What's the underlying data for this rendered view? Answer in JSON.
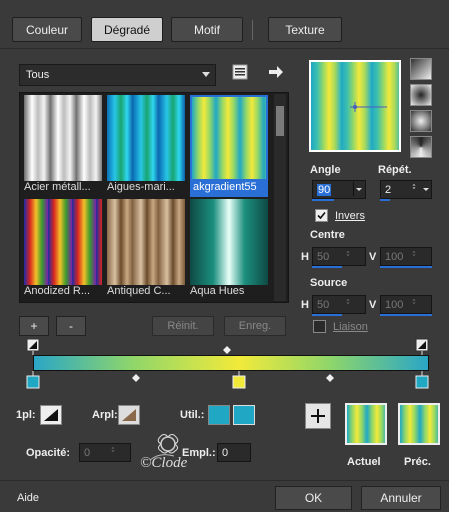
{
  "tabs": [
    {
      "label": "Couleur",
      "active": false
    },
    {
      "label": "Dégradé",
      "active": true
    },
    {
      "label": "Motif",
      "active": false
    },
    {
      "label": "Texture",
      "active": false
    }
  ],
  "category": {
    "value": "Tous"
  },
  "gallery": {
    "items": [
      {
        "label": "Acier métall...",
        "selected": false
      },
      {
        "label": "Aigues-mari...",
        "selected": false
      },
      {
        "label": "akgradient55",
        "selected": true
      },
      {
        "label": "Anodized R...",
        "selected": false
      },
      {
        "label": "Antiqued C...",
        "selected": false
      },
      {
        "label": "Aqua Hues",
        "selected": false
      }
    ]
  },
  "gallery_buttons": {
    "add": "+",
    "remove": "-",
    "reset": "Réinit.",
    "save": "Enreg."
  },
  "angle": {
    "label": "Angle",
    "value": "90"
  },
  "repeat": {
    "label": "Répét.",
    "value": "2"
  },
  "invert": {
    "label": "Invers",
    "checked": true
  },
  "center": {
    "label": "Centre",
    "h_label": "H",
    "h_value": "50",
    "v_label": "V",
    "v_value": "100"
  },
  "source": {
    "label": "Source",
    "h_label": "H",
    "h_value": "50",
    "v_label": "V",
    "v_value": "100"
  },
  "link": {
    "label": "Liaison",
    "checked": false
  },
  "stops": {
    "first_label": "1pl:",
    "bg_label": "Arpl:",
    "user_label": "Util.:",
    "opacity_label": "Opacité:",
    "opacity_value": "0",
    "location_label": "Empl.:",
    "location_value": "0",
    "user_color": "#1fa7c4"
  },
  "previews": {
    "current_label": "Actuel",
    "previous_label": "Préc."
  },
  "footer": {
    "help": "Aide",
    "ok": "OK",
    "cancel": "Annuler"
  },
  "watermark": "©Clode"
}
